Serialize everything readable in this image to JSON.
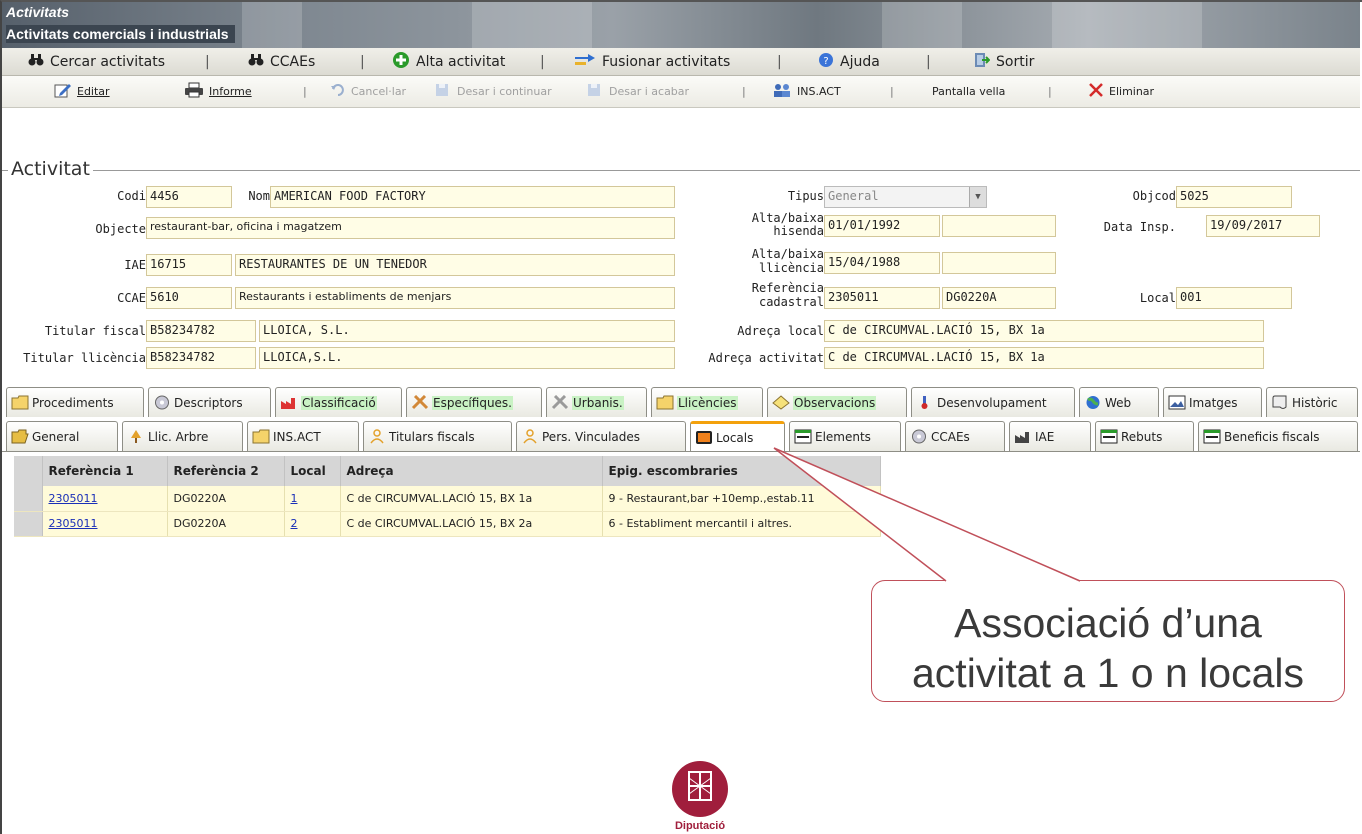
{
  "window": {
    "title": "Activitats",
    "subtitle": "Activitats comercials i industrials"
  },
  "mainmenu": {
    "search_activities": "Cercar activitats",
    "ccaes": "CCAEs",
    "new_activity": "Alta activitat",
    "merge_activities": "Fusionar activitats",
    "help": "Ajuda",
    "exit": "Sortir",
    "separator": "|"
  },
  "toolbar": {
    "edit": "Editar",
    "report": "Informe",
    "cancel": "Cancel·lar",
    "save_continue": "Desar i continuar",
    "save_finish": "Desar i acabar",
    "ins_act": "INS.ACT",
    "old_screen": "Pantalla vella",
    "delete": "Eliminar",
    "separator": "|"
  },
  "form": {
    "legend": "Activitat",
    "codi": {
      "label": "Codi",
      "value": "4456"
    },
    "nom": {
      "label": "Nom",
      "value": "AMERICAN FOOD FACTORY"
    },
    "tipus": {
      "label": "Tipus",
      "value": "General"
    },
    "objcod": {
      "label": "Objcod",
      "value": "5025"
    },
    "objecte": {
      "label": "Objecte",
      "value": "restaurant-bar, oficina i magatzem"
    },
    "alta_hisenda": {
      "label_1": "Alta/baixa",
      "label_2": "hisenda",
      "value": "01/01/1992",
      "value2": ""
    },
    "data_insp": {
      "label": "Data Insp.",
      "value": "19/09/2017"
    },
    "iae": {
      "label": "IAE",
      "code": "16715",
      "desc": "RESTAURANTES DE UN TENEDOR"
    },
    "alta_llicencia": {
      "label_1": "Alta/baixa",
      "label_2": "llicència",
      "value": "15/04/1988",
      "value2": ""
    },
    "ccae": {
      "label": "CCAE",
      "code": "5610",
      "desc": "Restaurants i establiments de menjars"
    },
    "ref_cadastral": {
      "label_1": "Referència",
      "label_2": "cadastral",
      "value": "2305011",
      "value2": "DG0220A"
    },
    "local": {
      "label": "Local",
      "value": "001"
    },
    "titular_fiscal": {
      "label": "Titular fiscal",
      "nif": "B58234782",
      "name": "LLOICA, S.L."
    },
    "adreca_local": {
      "label": "Adreça local",
      "value": "C de CIRCUMVAL.LACIÓ 15, BX 1a"
    },
    "titular_llicencia": {
      "label": "Titular llicència",
      "nif": "B58234782",
      "name": "LLOICA,S.L."
    },
    "adreca_activitat": {
      "label": "Adreça activitat",
      "value": "C de CIRCUMVAL.LACIÓ 15, BX 1a"
    }
  },
  "tabs_row1": [
    "Procediments",
    "Descriptors",
    "Classificació",
    "Específiques.",
    "Urbanis.",
    "Llicències",
    "Observacions",
    "Desenvolupament",
    "Web",
    "Imatges",
    "Històric"
  ],
  "tabs_row2": [
    "General",
    "Llic. Arbre",
    "INS.ACT",
    "Titulars fiscals",
    "Pers. Vinculades",
    "Locals",
    "Elements",
    "CCAEs",
    "IAE",
    "Rebuts",
    "Beneficis fiscals"
  ],
  "table": {
    "headers": [
      "Referència 1",
      "Referència 2",
      "Local",
      "Adreça",
      "Epig. escombraries"
    ],
    "rows": [
      [
        "2305011",
        "DG0220A",
        "1",
        "C de CIRCUMVAL.LACIÓ 15, BX 1a",
        "9 - Restaurant,bar +10emp.,estab.11"
      ],
      [
        "2305011",
        "DG0220A",
        "2",
        "C de CIRCUMVAL.LACIÓ 15, BX 2a",
        "6 - Establiment mercantil i altres."
      ]
    ]
  },
  "callout": {
    "line1": "Associació d’una",
    "line2": "activitat a 1 o n locals"
  },
  "logo": {
    "text": "Diputació"
  },
  "colors": {
    "accent_tab": "#f3a10c",
    "field_bg": "#fffde6",
    "link": "#1a2fb8",
    "callout_border": "#c0505a",
    "logo": "#a01e3c"
  }
}
